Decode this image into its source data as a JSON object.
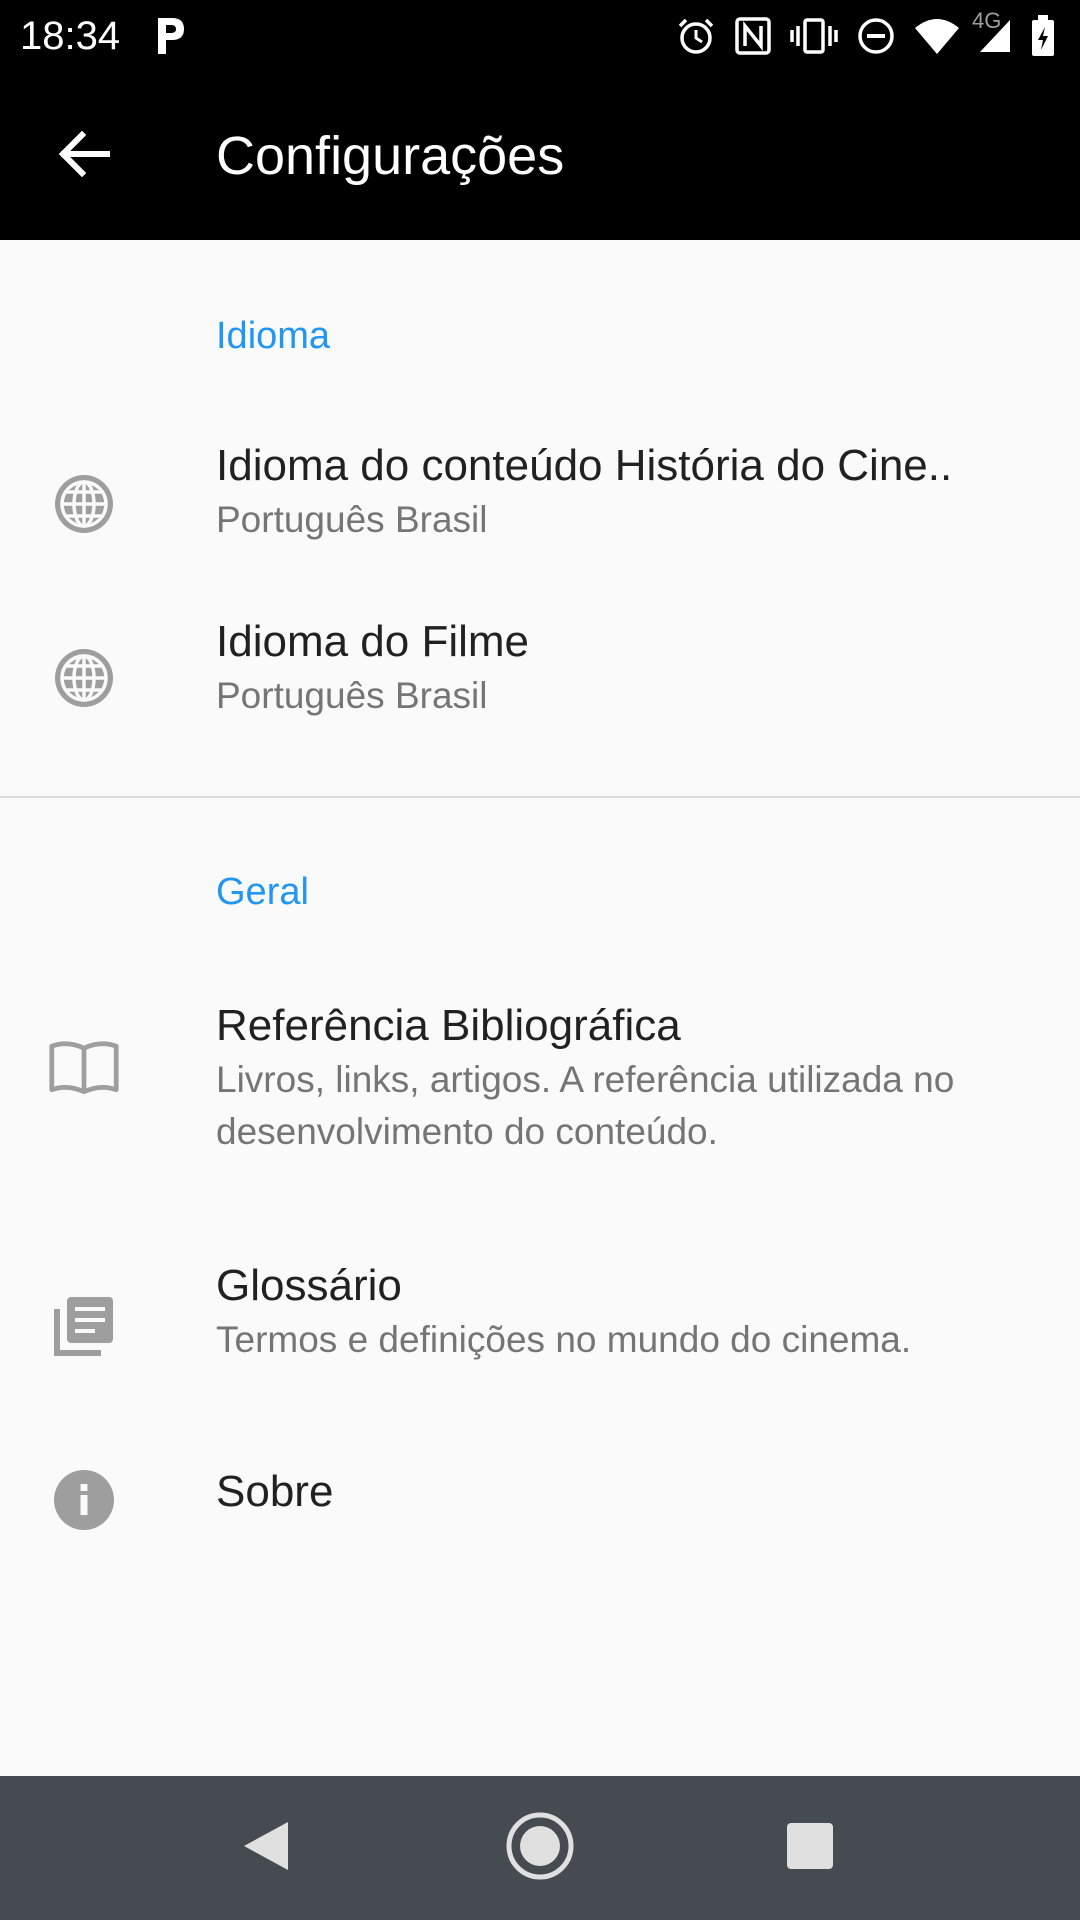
{
  "status_bar": {
    "time": "18:34",
    "network": "4G",
    "icons": [
      "parking-app-icon",
      "alarm-icon",
      "nfc-icon",
      "vibrate-icon",
      "do-not-disturb-icon",
      "wifi-icon",
      "cell-signal-icon",
      "battery-charging-icon"
    ]
  },
  "app_bar": {
    "title": "Configurações",
    "back_icon": "arrow-back-icon"
  },
  "sections": {
    "language": {
      "header": "Idioma",
      "items": [
        {
          "title": "Idioma do conteúdo História do Cine..",
          "summary": "Português Brasil",
          "icon": "globe-icon"
        },
        {
          "title": "Idioma do Filme",
          "summary": "Português Brasil",
          "icon": "globe-icon"
        }
      ]
    },
    "general": {
      "header": "Geral",
      "items": [
        {
          "title": "Referência Bibliográfica",
          "summary": "Livros, links, artigos. A referência utilizada no desenvolvimento do conteúdo.",
          "icon": "book-icon"
        },
        {
          "title": "Glossário",
          "summary": "Termos e definições no mundo do cinema.",
          "icon": "library-books-icon"
        },
        {
          "title": "Sobre",
          "icon": "info-icon"
        }
      ]
    }
  },
  "colors": {
    "accent": "#2196f3",
    "app_bar": "#000000",
    "background": "#fafafa",
    "icon_gray": "#9e9e9e",
    "nav_bar": "#454b50"
  },
  "nav_bar": {
    "buttons": [
      "nav-back-icon",
      "nav-home-icon",
      "nav-recents-icon"
    ]
  }
}
